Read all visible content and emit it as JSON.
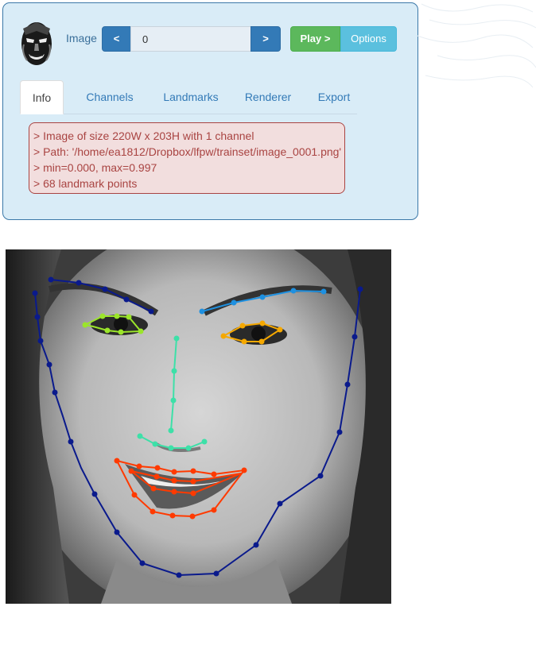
{
  "toolbar": {
    "image_label": "Image",
    "prev_label": "<",
    "frame_value": "0",
    "next_label": ">",
    "play_label": "Play >",
    "options_label": "Options"
  },
  "tabs": [
    {
      "label": "Info",
      "active": true
    },
    {
      "label": "Channels",
      "active": false
    },
    {
      "label": "Landmarks",
      "active": false
    },
    {
      "label": "Renderer",
      "active": false
    },
    {
      "label": "Export",
      "active": false
    }
  ],
  "info": {
    "lines": [
      "> Image of size 220W x 203H with 1 channel",
      "> Path: '/home/ea1812/Dropbox/lfpw/trainset/image_0001.png'",
      "> min=0.000, max=0.997",
      "> 68 landmark points"
    ]
  },
  "landmarks": {
    "count": 68,
    "group_colors": {
      "jaw": "#0a1a8c",
      "eyebrow_left": "#0a1a8c",
      "eyebrow_right": "#1e90e0",
      "eye_left": "#9be52a",
      "eye_right": "#f5a800",
      "nose": "#3de0a8",
      "mouth": "#ff3a00"
    }
  },
  "colors": {
    "panel_bg": "#d9ecf7",
    "primary": "#337ab7",
    "success": "#5cb85c",
    "info": "#5bc0de",
    "danger_text": "#a94442",
    "danger_bg": "#f2dede"
  }
}
